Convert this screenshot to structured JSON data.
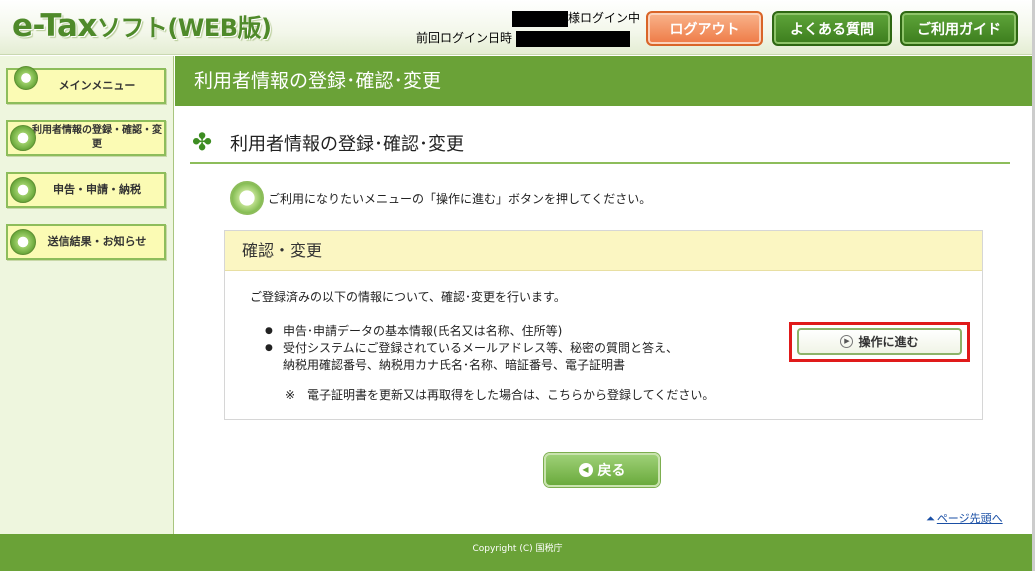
{
  "header": {
    "logo_main": "e-Tax",
    "logo_rest": "ソフト(WEB版)",
    "login_suffix": "様ログイン中",
    "last_login_label": "前回ログイン日時",
    "logout_label": "ログアウト",
    "faq_label": "よくある質問",
    "guide_label": "ご利用ガイド"
  },
  "sidebar": {
    "items": [
      {
        "label": "メインメニュー"
      },
      {
        "label": "利用者情報の登録・確認・変更"
      },
      {
        "label": "申告・申請・納税"
      },
      {
        "label": "送信結果・お知らせ"
      }
    ]
  },
  "titlebar": {
    "text": "利用者情報の登録･確認･変更"
  },
  "page_title": "利用者情報の登録･確認･変更",
  "instruction": "ご利用になりたいメニューの「操作に進む」ボタンを押してください。",
  "panel": {
    "heading": "確認・変更",
    "description": "ご登録済みの以下の情報について、確認･変更を行います。",
    "items": [
      "申告･申請データの基本情報(氏名又は名称、住所等)",
      "受付システムにご登録されているメールアドレス等、秘密の質問と答え、",
      "納税用確認番号、納税用カナ氏名･名称、暗証番号、電子証明書"
    ],
    "note": "※　電子証明書を更新又は再取得をした場合は、こちらから登録してください。",
    "proceed_label": "操作に進む"
  },
  "back_label": "戻る",
  "page_top_label": "ページ先頭へ",
  "footer": "Copyright (C) 国税庁",
  "colors": {
    "brand_green": "#6aa237",
    "logout_orange": "#ee7a45",
    "highlight_red": "#e01a1a"
  }
}
